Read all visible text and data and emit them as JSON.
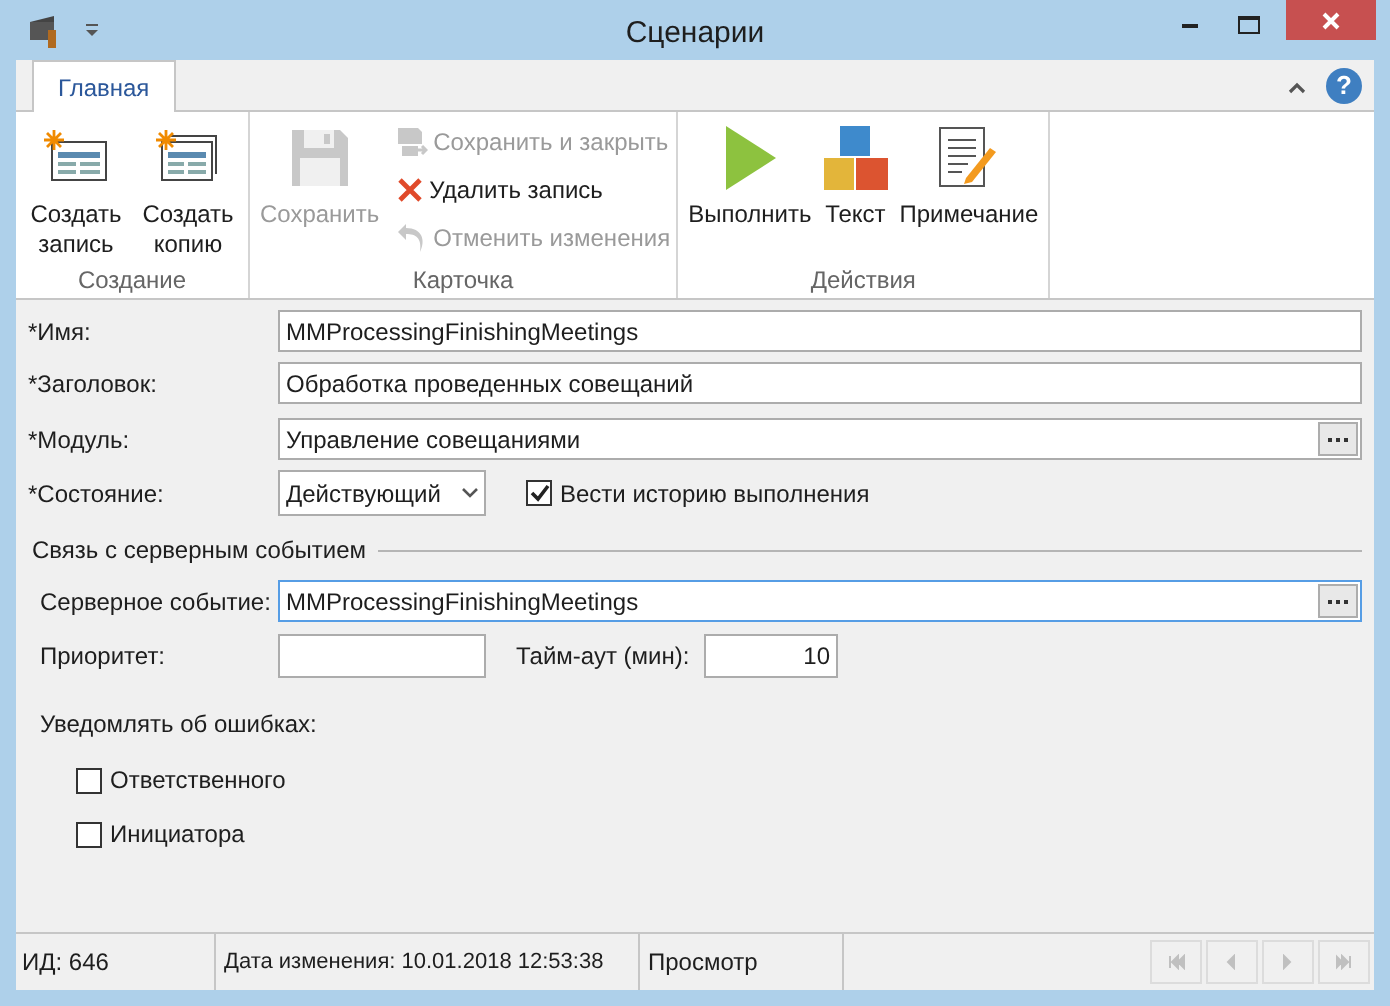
{
  "window": {
    "title": "Сценарии",
    "help": "?"
  },
  "ribbon": {
    "tabs": [
      {
        "label": "Главная",
        "selected": true
      }
    ],
    "groups": [
      {
        "label": "Создание",
        "items": [
          {
            "label": "Создать запись",
            "kind": "large",
            "disabled": false
          },
          {
            "label": "Создать копию",
            "kind": "large",
            "disabled": false
          }
        ]
      },
      {
        "label": "Карточка",
        "items": [
          {
            "label": "Сохранить",
            "kind": "large",
            "disabled": true
          },
          {
            "label": "Сохранить и закрыть",
            "kind": "small",
            "disabled": true
          },
          {
            "label": "Удалить запись",
            "kind": "small",
            "disabled": false
          },
          {
            "label": "Отменить изменения",
            "kind": "small",
            "disabled": true
          }
        ]
      },
      {
        "label": "Действия",
        "items": [
          {
            "label": "Выполнить",
            "kind": "large",
            "disabled": false
          },
          {
            "label": "Текст",
            "kind": "large",
            "disabled": false
          },
          {
            "label": "Примечание",
            "kind": "large",
            "disabled": false
          }
        ]
      }
    ]
  },
  "form": {
    "fields": [
      {
        "kind": "text",
        "label": "*Имя:",
        "value": "MMProcessingFinishingMeetings"
      },
      {
        "kind": "text",
        "label": "*Заголовок:",
        "value": "Обработка проведенных совещаний"
      },
      {
        "kind": "lookup",
        "label": "*Модуль:",
        "value": "Управление совещаниями"
      },
      {
        "kind": "select",
        "label": "*Состояние:",
        "value": "Действующий",
        "checkbox": {
          "label": "Вести историю выполнения",
          "checked": true
        }
      }
    ],
    "section": {
      "title": "Связь с серверным событием",
      "server_event": {
        "label": "Серверное событие:",
        "value": "MMProcessingFinishingMeetings",
        "focused": true
      },
      "priority": {
        "label": "Приоритет:"
      },
      "timeout": {
        "label": "Тайм-аут (мин):",
        "value": "10"
      },
      "notify": {
        "label": "Уведомлять об ошибках:",
        "options": [
          {
            "label": "Ответственного",
            "checked": false
          },
          {
            "label": "Инициатора",
            "checked": false
          }
        ]
      }
    }
  },
  "status_bar": {
    "id": "ИД: 646",
    "modified": "Дата изменения: 10.01.2018 12:53:38",
    "mode": "Просмотр",
    "nav": [
      {
        "kind": "first",
        "disabled": true
      },
      {
        "kind": "prev",
        "disabled": true
      },
      {
        "kind": "next",
        "disabled": true
      },
      {
        "kind": "last",
        "disabled": true
      }
    ]
  }
}
